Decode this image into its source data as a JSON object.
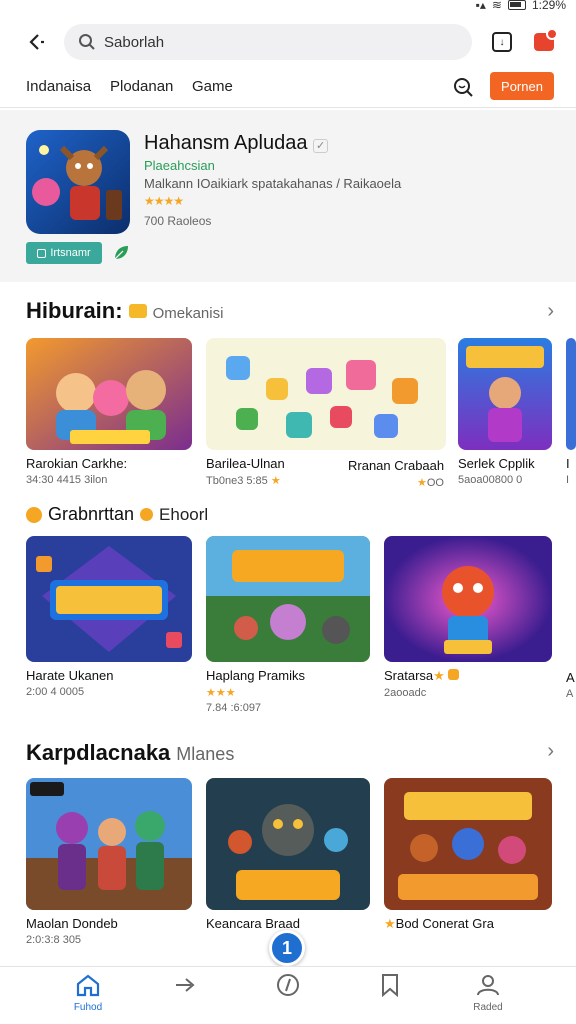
{
  "status": {
    "battery": "1:29%"
  },
  "search": {
    "value": "Saborlah"
  },
  "nav": {
    "tabs": [
      "Indanaisa",
      "Plodanan",
      "Game"
    ],
    "pro_button": "Pornen"
  },
  "featured": {
    "title": "Hahansm Apludaa",
    "subtitle": "Plaeahcsian",
    "description": "Malkann IOaikiark spatakahanas / Raikaoela",
    "rating": "★★★★",
    "count": "700 Raoleos",
    "install_label": "Irtsnamr"
  },
  "section1": {
    "title": "Hiburain:",
    "subtitle": "Omekanisi",
    "items": [
      {
        "name": "Rarokian Carkhe:",
        "meta": "34:30 4415 3ilon"
      },
      {
        "name": "Barilea-Ulnan",
        "meta": "Tb0ne3 5:85"
      },
      {
        "name": "Rranan Crabaah",
        "meta": "OO"
      },
      {
        "name": "Serlek Cpplik",
        "meta": "5aoa00800 0"
      },
      {
        "name": "I",
        "meta": "I"
      }
    ]
  },
  "section2": {
    "title": "Grabnrttan",
    "subtitle": "Ehoorl",
    "items": [
      {
        "name": "Harate Ukanen",
        "meta": "2:00 4 0005"
      },
      {
        "name": "Haplang Pramiks",
        "meta": "7.84 :6:097",
        "rating": "★★★"
      },
      {
        "name": "Sratarsa",
        "meta": "2aooadc"
      },
      {
        "name": "A",
        "meta": "A"
      }
    ]
  },
  "section3": {
    "title": "Karpdlacnaka",
    "subtitle": "Mlanes",
    "items": [
      {
        "name": "Maolan Dondeb",
        "meta": "2:0:3:8 305"
      },
      {
        "name": "Keancara Braad",
        "meta": ""
      },
      {
        "name": "Bod Conerat Gra",
        "meta": ""
      }
    ]
  },
  "bottom_nav": {
    "items": [
      {
        "label": "Fuhod",
        "icon": "home-icon"
      },
      {
        "label": "",
        "icon": "share-icon"
      },
      {
        "label": "",
        "icon": "compass-icon"
      },
      {
        "label": "",
        "icon": "bookmark-icon"
      },
      {
        "label": "Raded",
        "icon": "profile-icon"
      }
    ],
    "fab": "1"
  },
  "colors": {
    "accent": "#f26522",
    "primary": "#1f6fd1",
    "green": "#2a9d58"
  }
}
